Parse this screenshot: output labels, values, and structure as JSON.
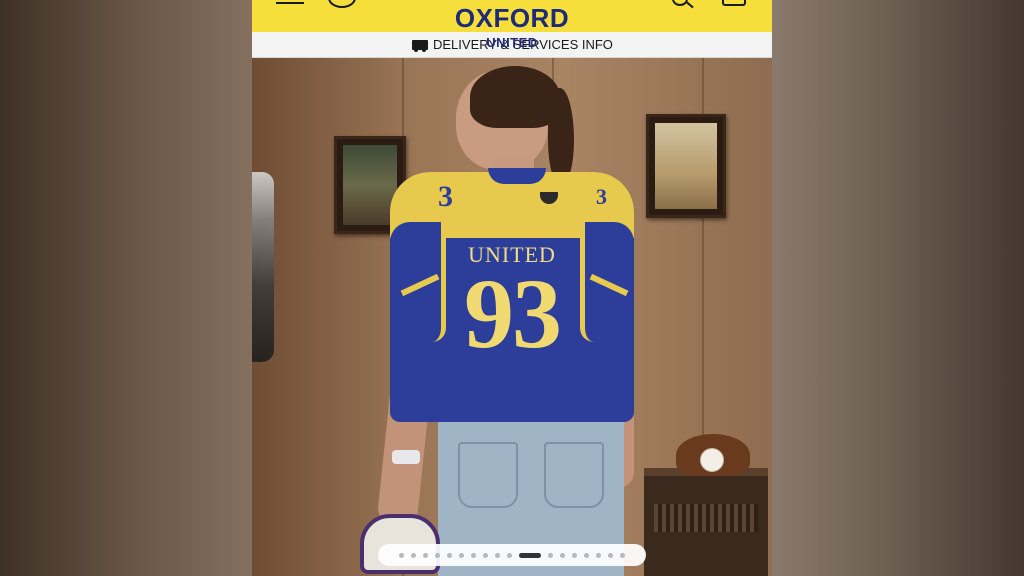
{
  "header": {
    "brand": "OXFORD",
    "brand_sub": "UNITED",
    "info_label": "DELIVERY & SERVICES INFO"
  },
  "photo": {
    "jersey_name": "UNITED",
    "jersey_number": "93",
    "shoulder_number_left": "3",
    "shoulder_number_right": "3"
  },
  "carousel": {
    "slide_count": 18,
    "active_index": 10
  },
  "colors": {
    "header_yellow": "#f6df3a",
    "brand_navy": "#1e2a7a",
    "jersey_blue": "#2c3e9a",
    "jersey_gold": "#e7c94e"
  },
  "icons": [
    "menu-icon",
    "ball-icon",
    "search-icon",
    "bag-icon",
    "truck-icon"
  ]
}
